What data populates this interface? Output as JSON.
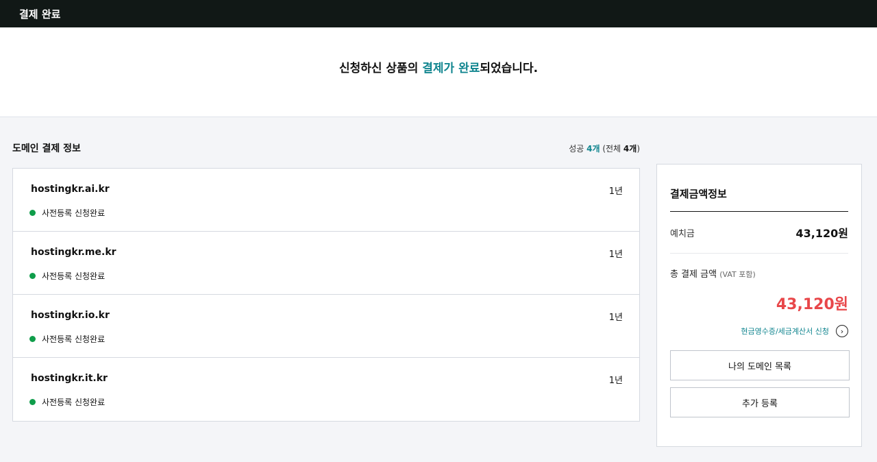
{
  "topbar": {
    "title": "결제 완료"
  },
  "hero": {
    "prefix": "신청하신 상품의 ",
    "highlight": "결제가 완료",
    "suffix": "되었습니다."
  },
  "section": {
    "title": "도메인 결제 정보",
    "summary": {
      "success_label": "성공 ",
      "success_count": "4개",
      "total_prefix": " (전체 ",
      "total_count": "4개",
      "total_suffix": ")"
    }
  },
  "domains": [
    {
      "name": "hostingkr.ai.kr",
      "period": "1년",
      "status": "사전등록 신청완료"
    },
    {
      "name": "hostingkr.me.kr",
      "period": "1년",
      "status": "사전등록 신청완료"
    },
    {
      "name": "hostingkr.io.kr",
      "period": "1년",
      "status": "사전등록 신청완료"
    },
    {
      "name": "hostingkr.it.kr",
      "period": "1년",
      "status": "사전등록 신청완료"
    }
  ],
  "status_color": "#0f9d4a",
  "payment": {
    "title": "결제금액정보",
    "deposit_label": "예치금",
    "deposit_value": "43,120원",
    "total_label": "총 결제 금액",
    "total_note": "(VAT 포함)",
    "total_value": "43,120원",
    "receipt_link": "현금영수증/세금계산서 신청",
    "receipt_icon": "chevron-right-icon",
    "buttons": {
      "my_domains": "나의 도메인 목록",
      "add_register": "추가 등록"
    }
  },
  "colors": {
    "accent": "#10858f",
    "total": "#e8474a",
    "topbar": "#111816"
  }
}
